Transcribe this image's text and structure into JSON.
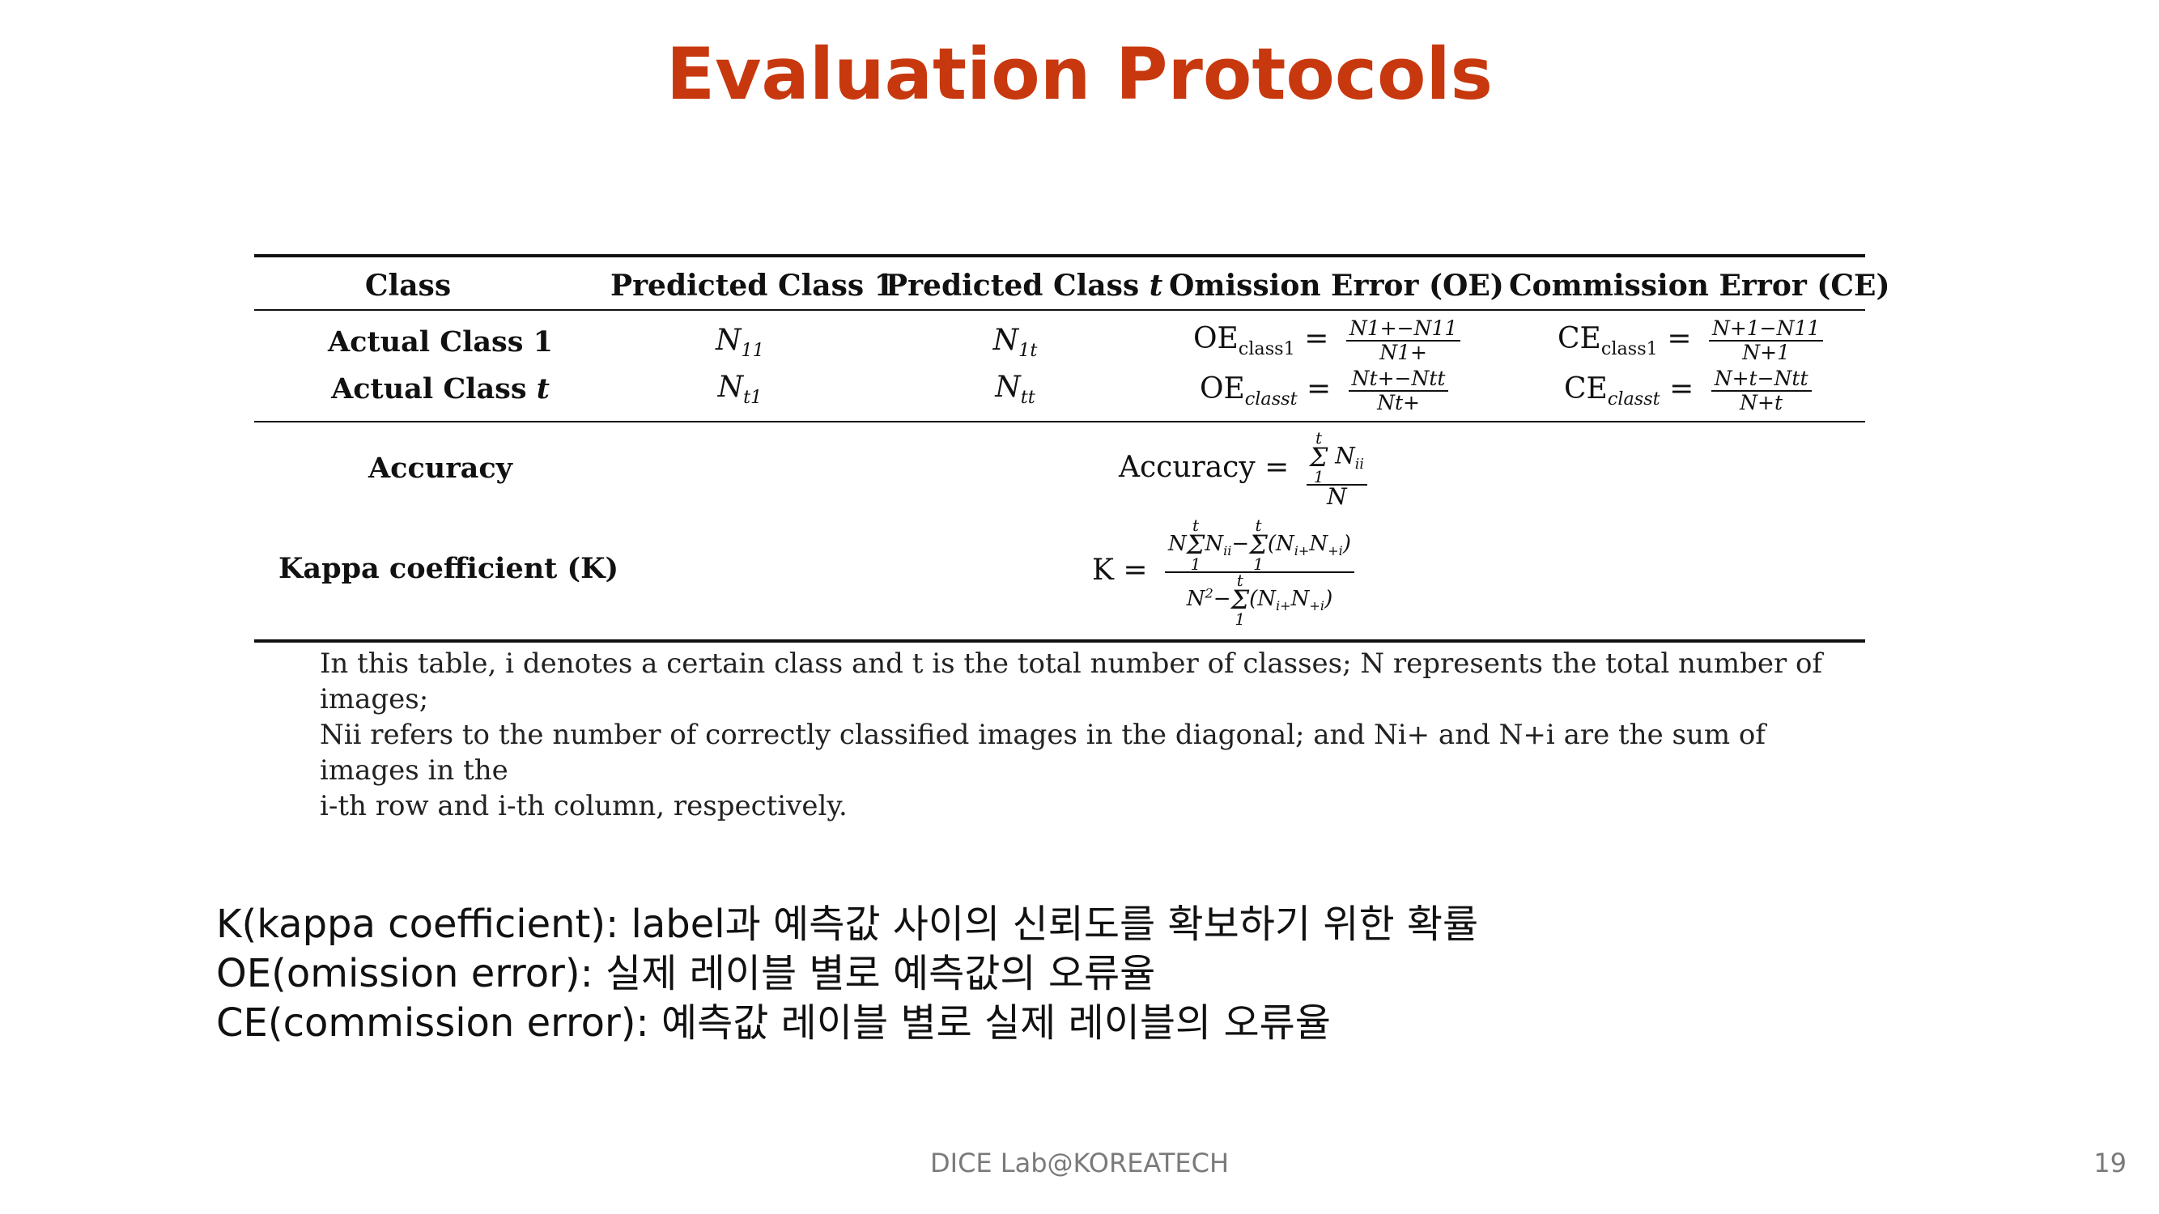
{
  "slide": {
    "title": "Evaluation Protocols",
    "footer": "DICE Lab@KOREATECH",
    "page_number": "19"
  },
  "table": {
    "headers": {
      "class": "Class",
      "pred1_text": "Predicted Class 1",
      "predt_text": "Predicted Class ",
      "predt_var": "t",
      "oe": "Omission Error (OE)",
      "ce": "Commission Error (CE)"
    },
    "rows": {
      "actual1_label": "Actual Class 1",
      "actualt_label_text": "Actual Class ",
      "actualt_label_var": "t",
      "n11": "N",
      "n11_sub": "11",
      "n1t": "N",
      "n1t_sub": "1t",
      "nt1": "N",
      "nt1_sub": "t1",
      "ntt": "N",
      "ntt_sub": "tt"
    },
    "formulas": {
      "oe1_lhs": "OE",
      "oe1_sub": "class1",
      "oe1_num": "N1+−N11",
      "oe1_den": "N1+",
      "oet_lhs": "OE",
      "oet_sub": "classt",
      "oet_num": "Nt+−Ntt",
      "oet_den": "Nt+",
      "ce1_lhs": "CE",
      "ce1_sub": "class1",
      "ce1_num": "N+1−N11",
      "ce1_den": "N+1",
      "cet_lhs": "CE",
      "cet_sub": "classt",
      "cet_num": "N+t−Ntt",
      "cet_den": "N+t"
    },
    "summary": {
      "accuracy_label": "Accuracy",
      "accuracy_lhs": "Accuracy =",
      "accuracy_den": "N",
      "kappa_label": "Kappa coefficient (K)",
      "kappa_lhs": "K ="
    },
    "note_line1": "In this table, i denotes a certain class and t is the total number of classes; N represents the total number of images;",
    "note_line2": "Nii refers to the number of correctly classified images in the diagonal; and Ni+ and N+i are the sum of images in the",
    "note_line3": "i-th row and i-th column, respectively."
  },
  "notes": [
    "K(kappa coefficient): label과 예측값 사이의 신뢰도를 확보하기 위한 확률",
    "OE(omission error): 실제 레이블 별로 예측값의 오류율",
    "CE(commission error): 예측값 레이블 별로 실제 레이블의 오류율"
  ]
}
